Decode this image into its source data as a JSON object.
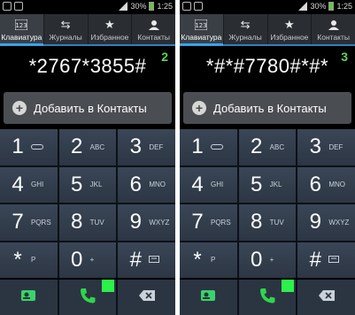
{
  "status_bar": {
    "battery": "30%",
    "time": "1:25"
  },
  "tabs": [
    {
      "label": "Клавиатура",
      "icon": "keypad-icon",
      "active": true
    },
    {
      "label": "Журналы",
      "icon": "call-log-icon",
      "active": false
    },
    {
      "label": "Избранное",
      "icon": "star-icon",
      "active": false
    },
    {
      "label": "Контакты",
      "icon": "contacts-icon",
      "active": false
    }
  ],
  "panels": [
    {
      "number": "*2767*3855#",
      "corner_label": "2",
      "add_contact_label": "Добавить в Контакты"
    },
    {
      "number": "*#*#7780#*#*",
      "corner_label": "3",
      "add_contact_label": "Добавить в Контакты"
    }
  ],
  "keys": [
    {
      "digit": "1",
      "sub": ""
    },
    {
      "digit": "2",
      "sub": "ABC"
    },
    {
      "digit": "3",
      "sub": "DEF"
    },
    {
      "digit": "4",
      "sub": "GHI"
    },
    {
      "digit": "5",
      "sub": "JKL"
    },
    {
      "digit": "6",
      "sub": "MNO"
    },
    {
      "digit": "7",
      "sub": "PQRS"
    },
    {
      "digit": "8",
      "sub": "TUV"
    },
    {
      "digit": "9",
      "sub": "WXYZ"
    },
    {
      "digit": "*",
      "sub": "P"
    },
    {
      "digit": "0",
      "sub": "+"
    },
    {
      "digit": "#",
      "sub": ""
    }
  ],
  "colors": {
    "accent": "#35a4f0",
    "call_green": "#2df04a",
    "corner_green": "#5fd35f"
  }
}
